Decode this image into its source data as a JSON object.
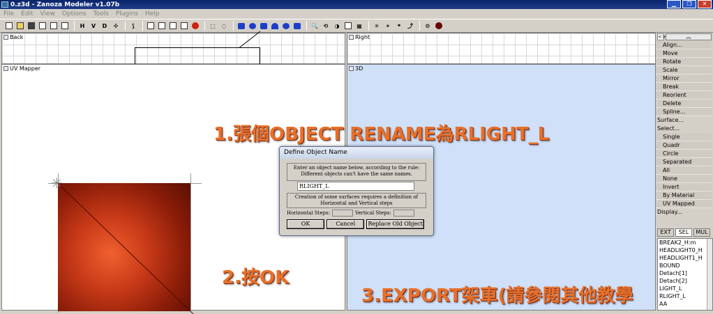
{
  "window": {
    "title": "0.z3d - Zanoza Modeler v1.07b",
    "btn_min": "▁",
    "btn_max": "❐",
    "btn_close": "✕"
  },
  "menu": [
    "File",
    "Edit",
    "View",
    "Options",
    "Tools",
    "Plugins",
    "Help"
  ],
  "toolbar": {
    "h_label": "H",
    "v_label": "V",
    "d_label": "D"
  },
  "panes": {
    "back": "Back",
    "right": "Right",
    "uv": "UV Mapper",
    "three_d": "3D"
  },
  "sidebar": {
    "toggle": "<>",
    "up_arrow": "︽",
    "commands": [
      {
        "label": "Align...",
        "sub": true
      },
      {
        "label": "Move",
        "sub": true
      },
      {
        "label": "Rotate",
        "sub": true
      },
      {
        "label": "Scale",
        "sub": true
      },
      {
        "label": "Mirror",
        "sub": true
      },
      {
        "label": "Break",
        "sub": true
      },
      {
        "label": "Reorient",
        "sub": true
      },
      {
        "label": "Delete",
        "sub": true
      },
      {
        "label": "Spline...",
        "sub": true
      },
      {
        "label": "Surface...",
        "sub": false
      },
      {
        "label": "Select...",
        "sub": false
      },
      {
        "label": "Single",
        "sub": true
      },
      {
        "label": "Quadr",
        "sub": true
      },
      {
        "label": "Circle",
        "sub": true
      },
      {
        "label": "Separated",
        "sub": true
      },
      {
        "label": "All",
        "sub": true
      },
      {
        "label": "None",
        "sub": true
      },
      {
        "label": "Invert",
        "sub": true
      },
      {
        "label": "By Material",
        "sub": true
      },
      {
        "label": "UV Mapped",
        "sub": true
      },
      {
        "label": "Display...",
        "sub": false
      }
    ],
    "tabs": [
      "EXT",
      "SEL",
      "MUL"
    ],
    "objects": [
      "BREAK2_H:m",
      "HEADLIGHT0_H",
      "HEADLIGHT1_H",
      "BOUND",
      "Detach[1]",
      "Detach[2]",
      "LIGHT_L",
      "RLIGHT_L",
      "AA"
    ]
  },
  "annotations": {
    "step1": "1.張個OBJECT  RENAME為RLIGHT_L",
    "step2": "2.按OK",
    "step3": "3.EXPORT架車(請參閱其他教學"
  },
  "dialog": {
    "title": "Define Object Name",
    "msg_line1": "Enter an object name below, according to the rule:",
    "msg_line2": "Different objects can't have the same names.",
    "name_value": "RLIGHT_L",
    "msg2_line1": "Creation of some surfaces requires a definition of",
    "msg2_line2": "Horizontal and Vertical steps",
    "h_steps": "Horizontal Steps:",
    "v_steps": "Vertical Steps:",
    "ok": "OK",
    "cancel": "Cancel",
    "replace": "Replace Old Object"
  }
}
